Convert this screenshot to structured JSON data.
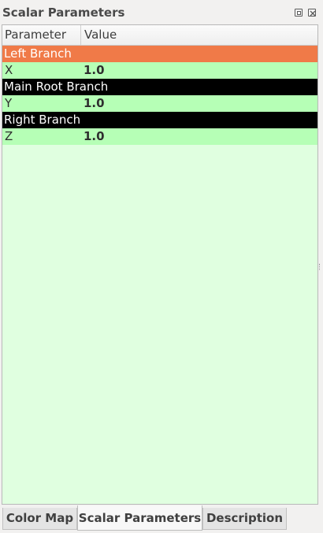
{
  "window": {
    "title": "Scalar Parameters",
    "float_button": "float-icon",
    "close_button": "close-icon"
  },
  "table": {
    "columns": [
      "Parameter",
      "Value"
    ],
    "rows": [
      {
        "type": "group",
        "label": "Left Branch",
        "selected": true
      },
      {
        "type": "param",
        "name": "X",
        "value": "1.0"
      },
      {
        "type": "group",
        "label": "Main Root Branch",
        "selected": false
      },
      {
        "type": "param",
        "name": "Y",
        "value": "1.0"
      },
      {
        "type": "group",
        "label": "Right Branch",
        "selected": false
      },
      {
        "type": "param",
        "name": "Z",
        "value": "1.0"
      }
    ]
  },
  "tabs": [
    {
      "label": "Color Map",
      "active": false
    },
    {
      "label": "Scalar Parameters",
      "active": true
    },
    {
      "label": "Description",
      "active": false
    }
  ],
  "colors": {
    "selected_group": "#f07a48",
    "group": "#000000",
    "param_row": "#b6ffb6",
    "table_background": "#e0ffe0"
  }
}
